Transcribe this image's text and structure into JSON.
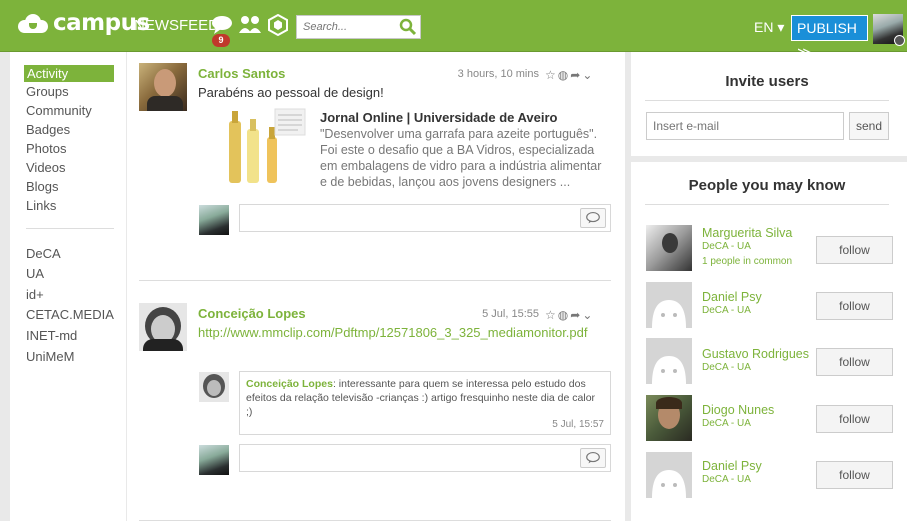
{
  "topbar": {
    "logo_text": "campus",
    "newsfeed": "NEWSFEED",
    "notification_count": "9",
    "search_placeholder": "Search...",
    "lang": "EN ▾",
    "publish": "PUBLISH ≫",
    "accent": "#7db33b",
    "publish_color": "#1a8fd8"
  },
  "sidebar": {
    "items": [
      "Activity",
      "Groups",
      "Community",
      "Badges",
      "Photos",
      "Videos",
      "Blogs",
      "Links"
    ],
    "groups": [
      "DeCA",
      "UA",
      "id+",
      "CETAC.MEDIA",
      "INET-md",
      "UniMeM"
    ]
  },
  "feed": {
    "posts": [
      {
        "author": "Carlos Santos",
        "time": "3 hours, 10 mins",
        "text": "Parabéns ao pessoal de design!",
        "link_title": "Jornal Online | Universidade de Aveiro",
        "link_desc": "\"Desenvolver uma garrafa para azeite português\". Foi este o desafio que a BA Vidros, especializada em embalagens de vidro para a indústria alimentar e de bebidas, lançou aos jovens designers ..."
      },
      {
        "author": "Conceição Lopes",
        "time": "5 Jul, 15:55",
        "link": "http://www.mmclip.com/Pdftmp/12571806_3_325_mediamonitor.pdf",
        "comment": {
          "author": "Conceição Lopes",
          "text": ": interessante para quem se interessa pelo estudo dos efeitos da relação televisão -crianças :) artigo fresquinho neste dia de calor ;)",
          "time": "5 Jul, 15:57"
        }
      }
    ]
  },
  "invite": {
    "title": "Invite users",
    "placeholder": "Insert e-mail",
    "send": "send"
  },
  "people": {
    "title": "People you may know",
    "follow_label": "follow",
    "list": [
      {
        "name": "Marguerita Silva",
        "org": "DeCA - UA",
        "common": "1 people in common"
      },
      {
        "name": "Daniel Psy",
        "org": "DeCA - UA",
        "common": ""
      },
      {
        "name": "Gustavo Rodrigues",
        "org": "DeCA - UA",
        "common": ""
      },
      {
        "name": "Diogo Nunes",
        "org": "DeCA - UA",
        "common": ""
      },
      {
        "name": "Daniel Psy",
        "org": "DeCA - UA",
        "common": ""
      }
    ]
  }
}
